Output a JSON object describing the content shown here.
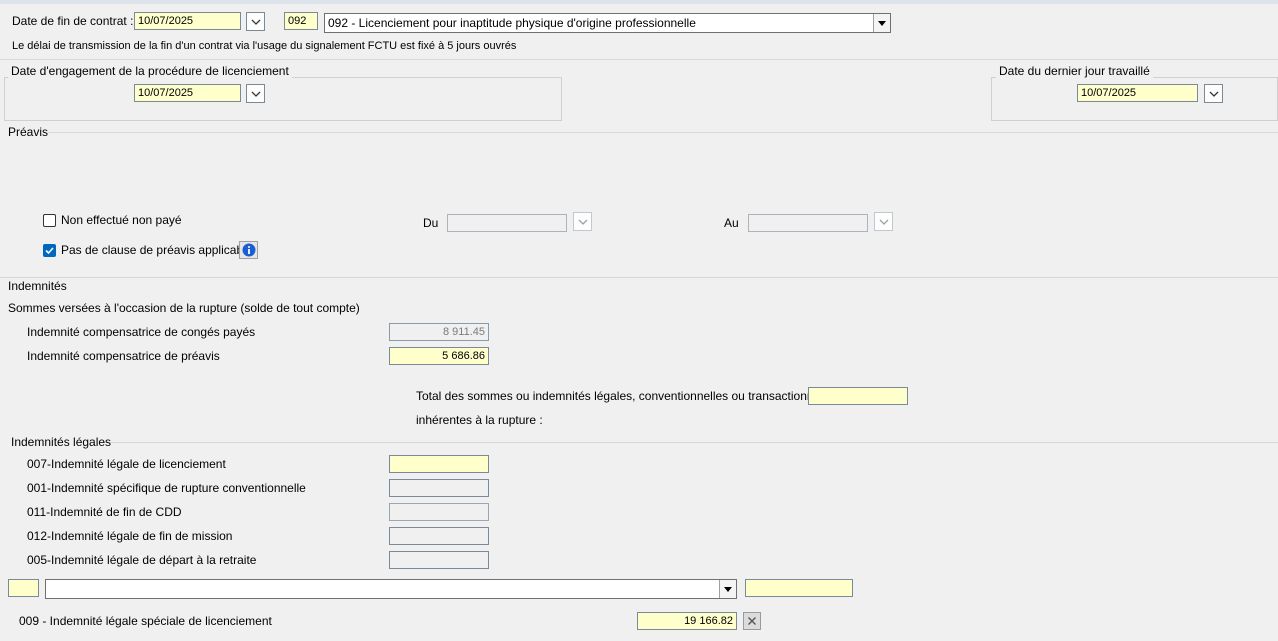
{
  "contract_end": {
    "label": "Date de fin de contrat :",
    "date_value": "10/07/2025",
    "motif_code": "092",
    "motif_selected": "092 - Licenciement pour inaptitude physique d'origine professionnelle",
    "info_text": "Le délai de transmission de la fin d'un contrat via l'usage du signalement FCTU est fixé à 5 jours ouvrés"
  },
  "engagement": {
    "legend": "Date d'engagement de la procédure de licenciement",
    "date_value": "10/07/2025"
  },
  "last_day": {
    "legend": "Date du dernier jour travaillé",
    "date_value": "10/07/2025"
  },
  "preavis": {
    "legend": "Préavis",
    "non_effectue_label": "Non effectué non payé",
    "non_effectue_checked": false,
    "pas_clause_label": "Pas de clause de préavis applicable",
    "pas_clause_checked": true,
    "du_label": "Du",
    "du_value": "",
    "au_label": "Au",
    "au_value": ""
  },
  "indemnites": {
    "legend": "Indemnités",
    "subtitle": "Sommes versées à l'occasion de la rupture (solde de tout compte)",
    "conges_label": "Indemnité compensatrice de congés payés",
    "conges_value": "8 911.45",
    "preavis_label": "Indemnité compensatrice de préavis",
    "preavis_value": "5 686.86",
    "total_label_line1": "Total des sommes ou indemnités légales, conventionnelles ou transactionnelles",
    "total_label_line2": "inhérentes à la rupture :",
    "total_value": ""
  },
  "legales": {
    "legend": "Indemnités légales",
    "items": [
      {
        "label": "007-Indemnité légale de licenciement",
        "value": ""
      },
      {
        "label": "001-Indemnité spécifique de rupture conventionnelle",
        "value": ""
      },
      {
        "label": "011-Indemnité de fin de CDD",
        "value": ""
      },
      {
        "label": "012-Indemnité légale de fin de mission",
        "value": ""
      },
      {
        "label": "005-Indemnité légale de départ à la retraite",
        "value": ""
      }
    ],
    "extra_code": "",
    "extra_selected": "",
    "extra_value": "",
    "special_label": "009 - Indemnité légale spéciale de licenciement",
    "special_value": "19 166.82"
  },
  "icons": {
    "dropdown": "chevron-down-icon",
    "info": "info-icon",
    "clear": "close-icon",
    "check": "checkmark-icon"
  },
  "colors": {
    "input_yellow": "#ffffcc",
    "accent_blue": "#0067c0"
  }
}
